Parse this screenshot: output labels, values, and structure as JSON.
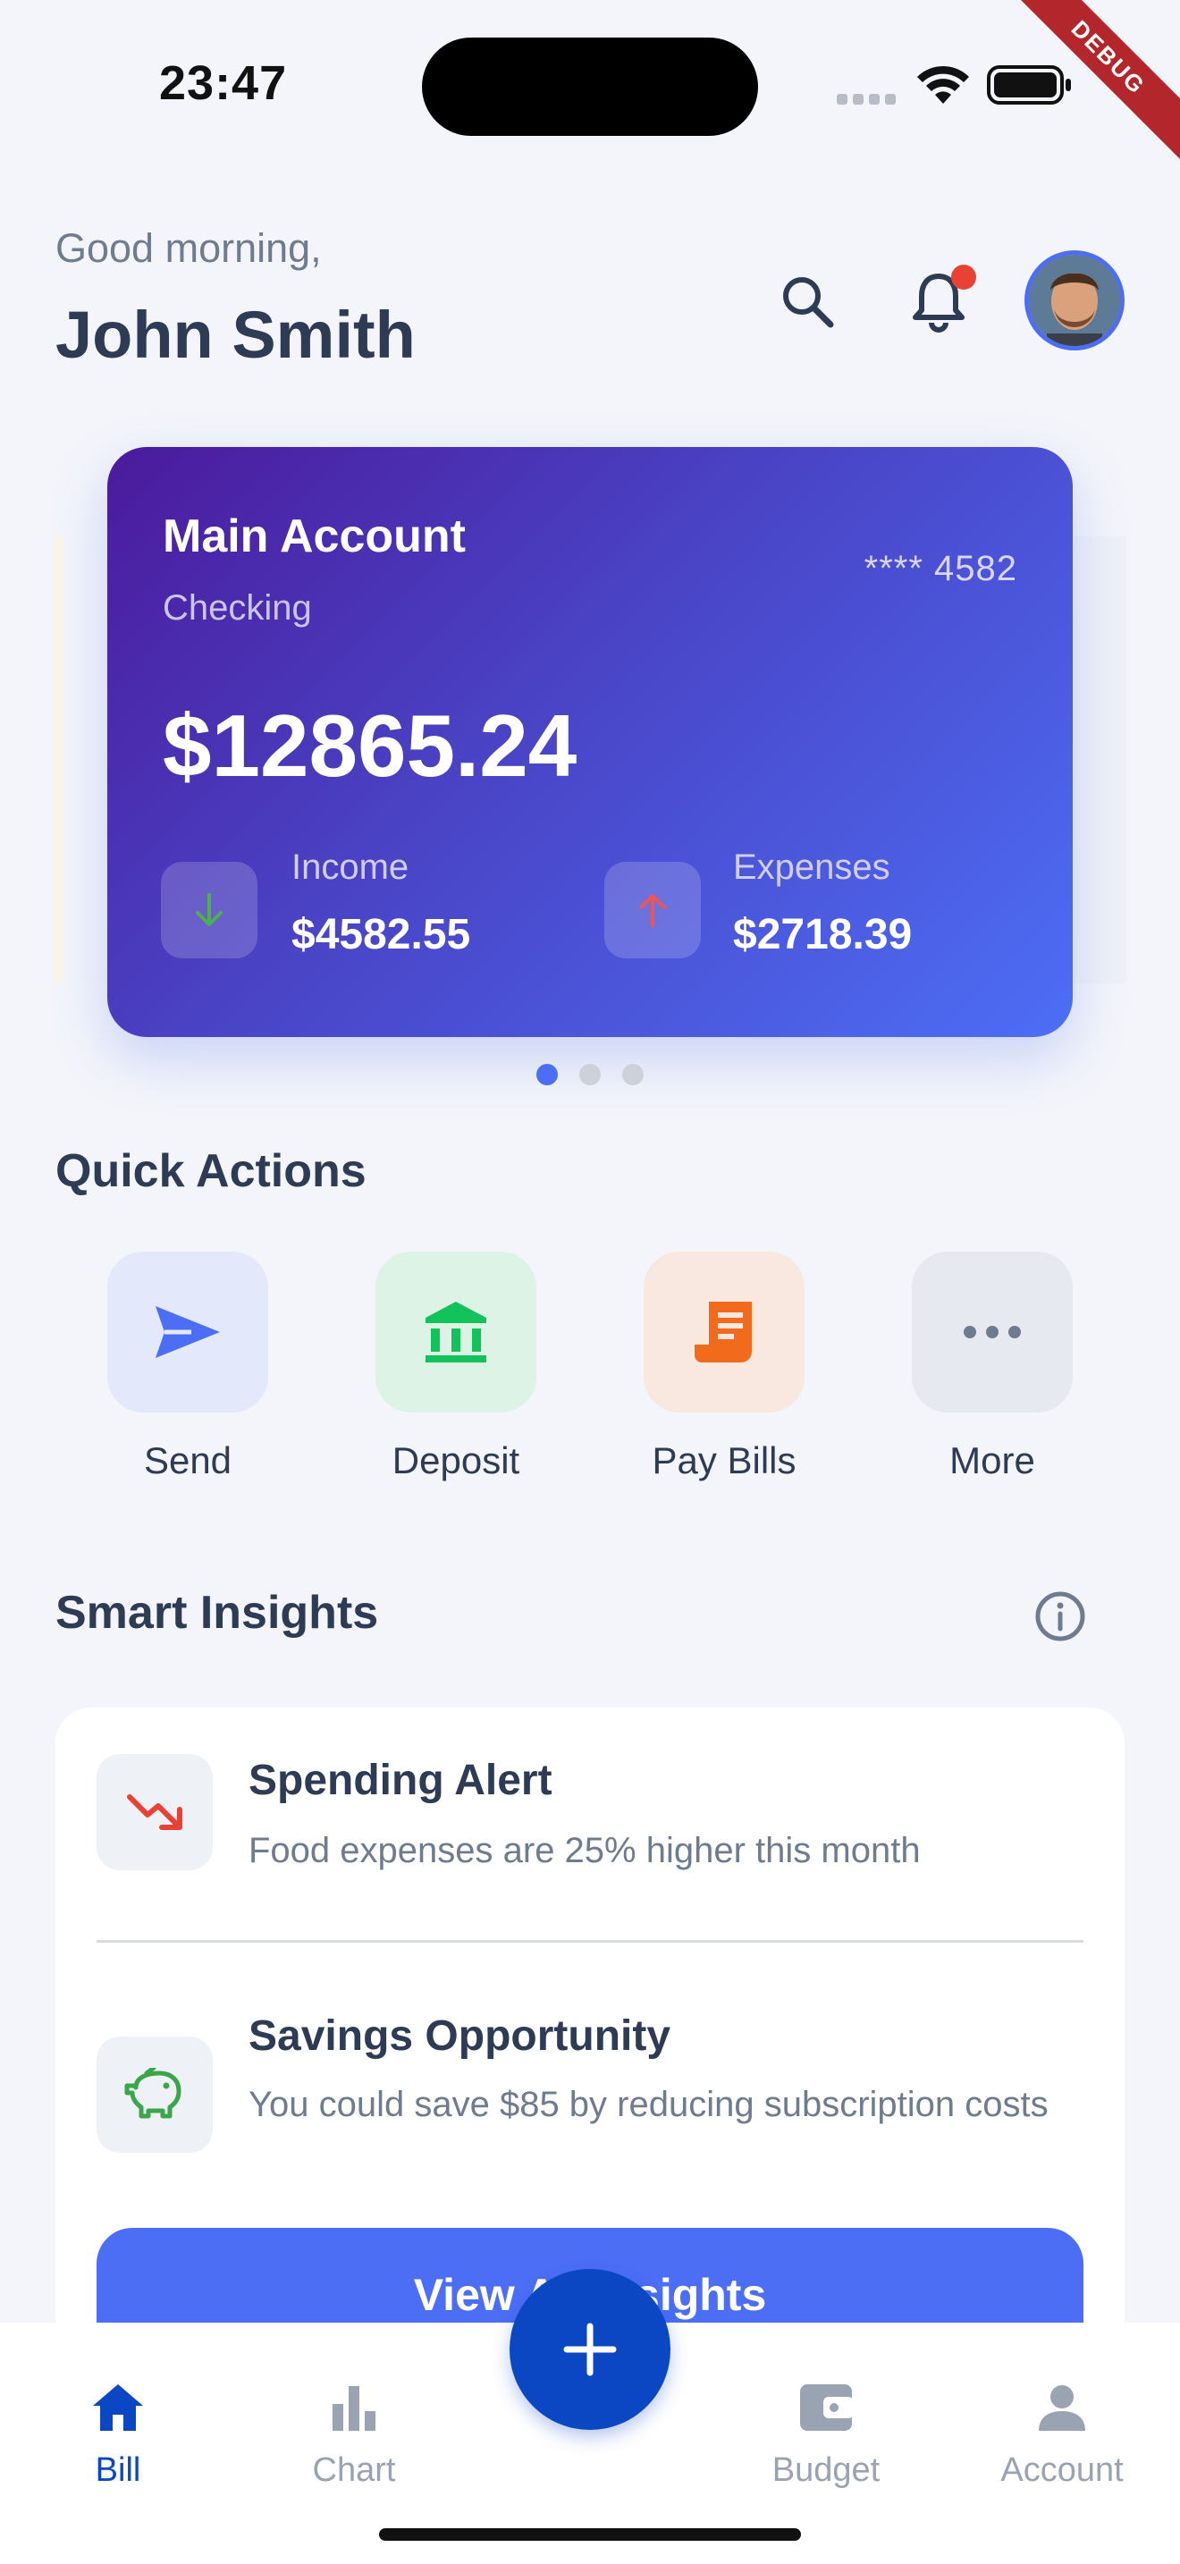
{
  "status_bar": {
    "time": "23:47",
    "debug_label": "DEBUG"
  },
  "header": {
    "greeting": "Good morning,",
    "user_name": "John Smith"
  },
  "account_card": {
    "title": "Main Account",
    "type": "Checking",
    "masked_number": "**** 4582",
    "balance": "$12865.24",
    "income_label": "Income",
    "income_value": "$4582.55",
    "expenses_label": "Expenses",
    "expenses_value": "$2718.39",
    "page_count": 3,
    "active_page": 1
  },
  "quick_actions": {
    "title": "Quick Actions",
    "items": [
      {
        "label": "Send",
        "icon": "send-icon",
        "color": "#4c6ef5",
        "bg": "#e3e9fb"
      },
      {
        "label": "Deposit",
        "icon": "bank-icon",
        "color": "#12c25a",
        "bg": "#dcf3e5"
      },
      {
        "label": "Pay Bills",
        "icon": "receipt-icon",
        "color": "#f26b1d",
        "bg": "#f8e8df"
      },
      {
        "label": "More",
        "icon": "more-icon",
        "color": "#6f7b8e",
        "bg": "#e6e9ef"
      }
    ]
  },
  "insights": {
    "title": "Smart Insights",
    "items": [
      {
        "title": "Spending Alert",
        "description": "Food expenses are 25% higher this month",
        "icon": "trending-down-icon"
      },
      {
        "title": "Savings Opportunity",
        "description": "You could save $85 by reducing subscription costs",
        "icon": "piggy-bank-icon"
      }
    ],
    "button_label": "View All Insights"
  },
  "bottom_nav": {
    "items": [
      {
        "label": "Bill",
        "icon": "home-icon",
        "active": true
      },
      {
        "label": "Chart",
        "icon": "bar-chart-icon",
        "active": false
      },
      {
        "label": "Budget",
        "icon": "wallet-icon",
        "active": false
      },
      {
        "label": "Account",
        "icon": "person-icon",
        "active": false
      }
    ],
    "fab_icon": "plus-icon"
  },
  "colors": {
    "accent": "#4c6ef5",
    "primary_nav": "#0b47c3",
    "alert": "#e94235"
  }
}
